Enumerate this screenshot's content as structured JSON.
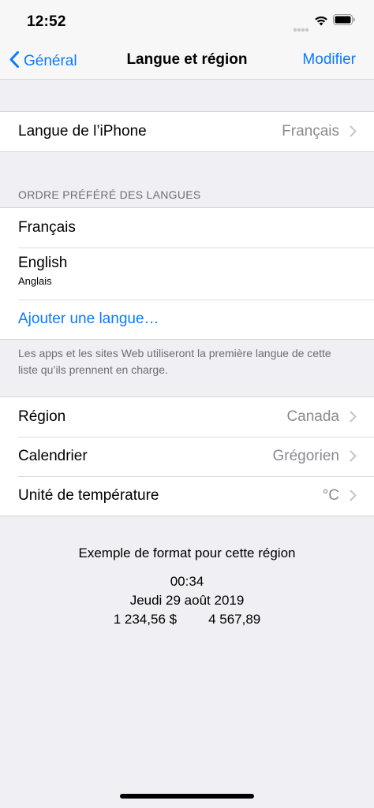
{
  "status": {
    "time": "12:52"
  },
  "nav": {
    "back_label": "Général",
    "title": "Langue et région",
    "action_label": "Modifier"
  },
  "iphone_language": {
    "label": "Langue de l’iPhone",
    "value": "Français"
  },
  "preferred_languages": {
    "header": "ORDRE PRÉFÉRÉ DES LANGUES",
    "items": [
      {
        "title": "Français",
        "subtitle": ""
      },
      {
        "title": "English",
        "subtitle": "Anglais"
      }
    ],
    "add_label": "Ajouter une langue…",
    "footer": "Les apps et les sites Web utiliseront la première langue de cette liste qu’ils prennent en charge."
  },
  "region_settings": [
    {
      "label": "Région",
      "value": "Canada"
    },
    {
      "label": "Calendrier",
      "value": "Grégorien"
    },
    {
      "label": "Unité de température",
      "value": "°C"
    }
  ],
  "format_example": {
    "title": "Exemple de format pour cette région",
    "time": "00:34",
    "date": "Jeudi 29 août 2019",
    "currency": "1 234,56 $",
    "number": "4 567,89"
  },
  "colors": {
    "accent": "#0a7aff",
    "background": "#efeff4",
    "secondary_text": "#8a8a8f"
  }
}
